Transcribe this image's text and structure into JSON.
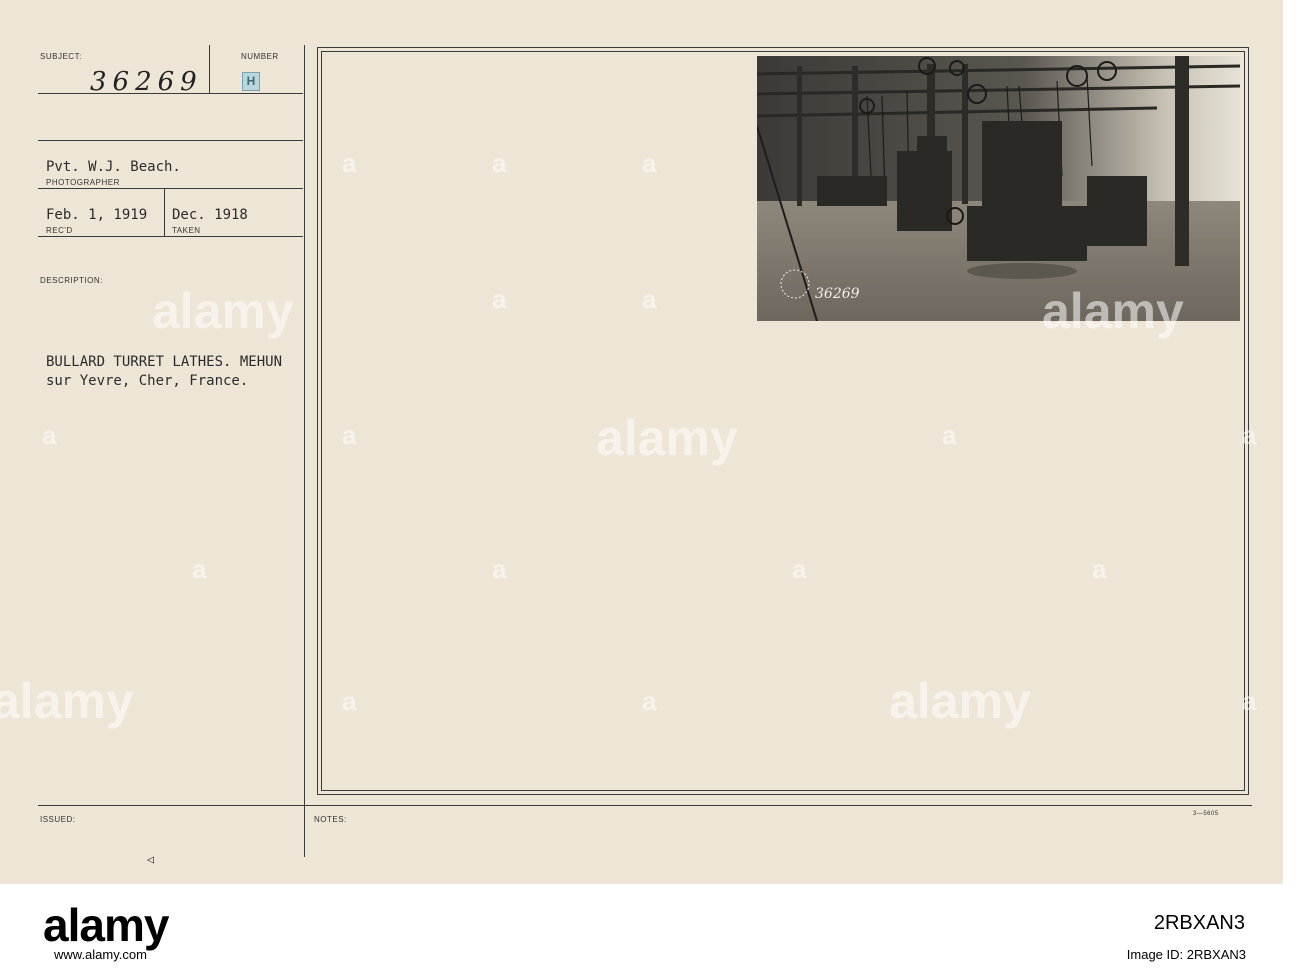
{
  "card": {
    "subject_label": "SUBJECT:",
    "number_label": "NUMBER",
    "subject_number": "36269",
    "number_stamp": "H",
    "photographer_name": "Pvt. W.J. Beach.",
    "photographer_label": "PHOTOGRAPHER",
    "received_date": "Feb. 1, 1919",
    "received_label": "REC'D",
    "taken_date": "Dec. 1918",
    "taken_label": "TAKEN",
    "description_label": "DESCRIPTION:",
    "description_line1": "BULLARD TURRET LATHES. MEHUN",
    "description_line2": "sur Yevre, Cher, France.",
    "issued_label": "ISSUED:",
    "notes_label": "NOTES:",
    "form_number": "3—5605",
    "photo_number": "36269"
  },
  "watermark": {
    "text": "alamy",
    "letter": "a"
  },
  "footer": {
    "logo": "alamy",
    "url": "www.alamy.com",
    "image_id_label": "Image ID: 2RBXAN3",
    "image_id": "2RBXAN3"
  },
  "colors": {
    "card_background": "#ede5d6",
    "ink": "#2b2b2b",
    "stamp": "#b9d6dc"
  }
}
